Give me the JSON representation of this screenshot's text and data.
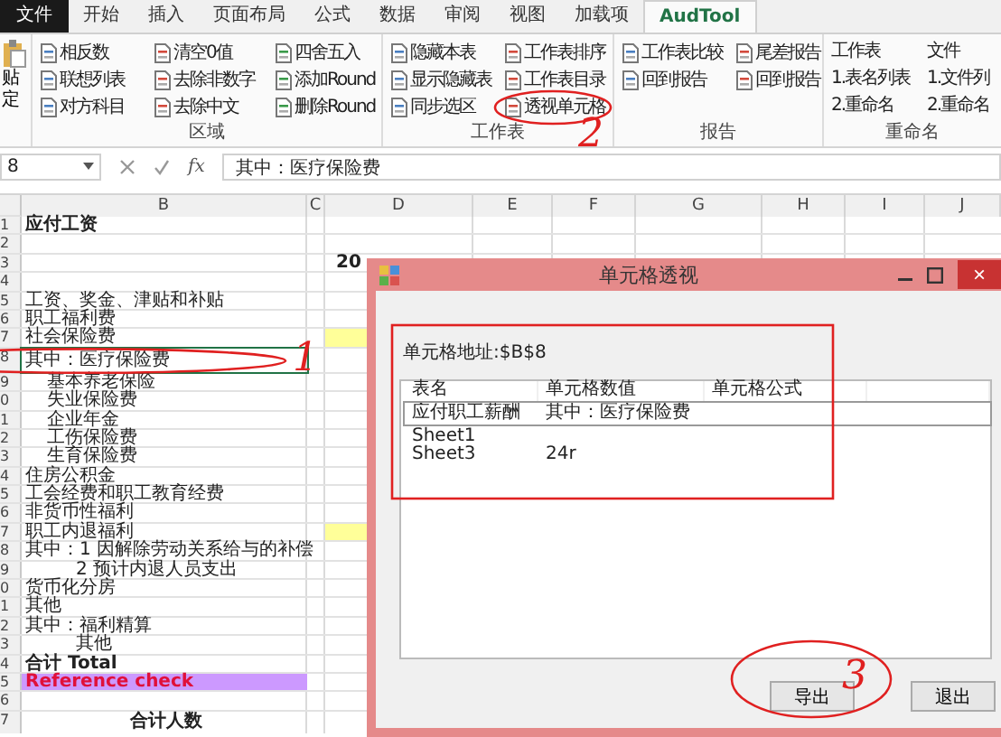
{
  "tabs": [
    {
      "label": "文件",
      "kind": "file",
      "selected": false
    },
    {
      "label": "开始",
      "kind": "tab",
      "selected": false
    },
    {
      "label": "插入",
      "kind": "tab",
      "selected": false
    },
    {
      "label": "页面布局",
      "kind": "tab",
      "selected": false
    },
    {
      "label": "公式",
      "kind": "tab",
      "selected": false
    },
    {
      "label": "数据",
      "kind": "tab",
      "selected": false
    },
    {
      "label": "审阅",
      "kind": "tab",
      "selected": false
    },
    {
      "label": "视图",
      "kind": "tab",
      "selected": false
    },
    {
      "label": "加载项",
      "kind": "tab",
      "selected": false
    },
    {
      "label": "AudTool",
      "kind": "tab",
      "selected": true
    }
  ],
  "ribbon": {
    "paste_button": [
      "贴",
      "定"
    ],
    "groups": [
      {
        "label": "区域",
        "kind": "icons",
        "columns": [
          [
            "相反数",
            "联想列表",
            "对方科目"
          ],
          [
            "清空0值",
            "去除非数字",
            "去除中文"
          ],
          [
            "四舍五入",
            "添加Round",
            "删除Round"
          ]
        ]
      },
      {
        "label": "工作表",
        "kind": "icons",
        "columns": [
          [
            "隐藏本表",
            "显示隐藏表",
            "同步选区"
          ],
          [
            "工作表排序",
            "工作表目录",
            "透视单元格"
          ]
        ]
      },
      {
        "label": "报告",
        "kind": "icons",
        "columns": [
          [
            "工作表比较",
            "回到报告"
          ],
          [
            "尾差报告",
            "回到报告"
          ]
        ]
      },
      {
        "label": "重命名",
        "kind": "text",
        "columns": [
          [
            "工作表",
            "1.表名列表",
            "2.重命名"
          ],
          [
            "文件",
            "1.文件列",
            "2.重命名"
          ]
        ]
      }
    ]
  },
  "formula_bar": {
    "name_box": "8",
    "fx": "fx",
    "formula": "其中：医疗保险费"
  },
  "sheet": {
    "columns": [
      "B",
      "C",
      "D",
      "E",
      "F",
      "G",
      "H",
      "I",
      "J"
    ],
    "rows": [
      {
        "row": "1",
        "text": "应付工资",
        "kind": "title",
        "selected": false,
        "highlight": false
      },
      {
        "row": "2",
        "text": "",
        "kind": "plain",
        "selected": false,
        "highlight": false
      },
      {
        "row": "3",
        "text": "",
        "kind": "plain",
        "selected": false,
        "highlight": false,
        "d": "20"
      },
      {
        "row": "4",
        "text": "",
        "kind": "plain",
        "selected": false,
        "highlight": false
      },
      {
        "row": "5",
        "text": "工资、奖金、津贴和补贴",
        "kind": "plain",
        "selected": false,
        "highlight": false
      },
      {
        "row": "6",
        "text": "职工福利费",
        "kind": "plain",
        "selected": false,
        "highlight": false
      },
      {
        "row": "7",
        "text": "社会保险费",
        "kind": "plain",
        "selected": false,
        "highlight": true
      },
      {
        "row": "8",
        "text": "其中：医疗保险费",
        "kind": "plain",
        "selected": true,
        "highlight": false
      },
      {
        "row": "9",
        "text": "基本养老保险",
        "kind": "indent",
        "selected": false,
        "highlight": false
      },
      {
        "row": "0",
        "text": "失业保险费",
        "kind": "indent",
        "selected": false,
        "highlight": false
      },
      {
        "row": "1",
        "text": "企业年金",
        "kind": "indent",
        "selected": false,
        "highlight": false
      },
      {
        "row": "2",
        "text": "工伤保险费",
        "kind": "indent",
        "selected": false,
        "highlight": false
      },
      {
        "row": "3",
        "text": "生育保险费",
        "kind": "indent",
        "selected": false,
        "highlight": false
      },
      {
        "row": "4",
        "text": "住房公积金",
        "kind": "plain",
        "selected": false,
        "highlight": false
      },
      {
        "row": "5",
        "text": "工会经费和职工教育经费",
        "kind": "plain",
        "selected": false,
        "highlight": false
      },
      {
        "row": "6",
        "text": "非货币性福利",
        "kind": "plain",
        "selected": false,
        "highlight": false
      },
      {
        "row": "7",
        "text": "职工内退福利",
        "kind": "plain",
        "selected": false,
        "highlight": true
      },
      {
        "row": "8",
        "text": "其中：1 因解除劳动关系给与的补偿",
        "kind": "plain",
        "selected": false,
        "highlight": false
      },
      {
        "row": "9",
        "text": "2 预计内退人员支出",
        "kind": "indent2",
        "selected": false,
        "highlight": false
      },
      {
        "row": "0",
        "text": "货币化分房",
        "kind": "plain",
        "selected": false,
        "highlight": false
      },
      {
        "row": "1",
        "text": "其他",
        "kind": "plain",
        "selected": false,
        "highlight": false
      },
      {
        "row": "2",
        "text": "其中：福利精算",
        "kind": "plain",
        "selected": false,
        "highlight": false
      },
      {
        "row": "3",
        "text": "其他",
        "kind": "indent2",
        "selected": false,
        "highlight": false
      },
      {
        "row": "4",
        "text": "合计 Total",
        "kind": "title",
        "selected": false,
        "highlight": false
      },
      {
        "row": "5",
        "text": "Reference check",
        "kind": "check",
        "selected": false,
        "highlight": false
      },
      {
        "row": "6",
        "text": "",
        "kind": "plain",
        "selected": false,
        "highlight": false
      },
      {
        "row": "7",
        "text": "合计人数",
        "kind": "center",
        "selected": false,
        "highlight": false
      }
    ]
  },
  "dialog": {
    "title": "单元格透视",
    "close": "×",
    "address": "单元格地址:$B$8",
    "columns": [
      "表名",
      "单元格数值",
      "单元格公式"
    ],
    "rows": [
      {
        "cells": [
          "应付职工薪酬",
          "其中：医疗保险费",
          ""
        ],
        "selected": true
      },
      {
        "cells": [
          "Sheet1",
          "",
          ""
        ],
        "selected": false
      },
      {
        "cells": [
          "Sheet3",
          "24r",
          ""
        ],
        "selected": false
      }
    ],
    "buttons": [
      "导出",
      "退出"
    ]
  },
  "annotations": [
    {
      "kind": "circle",
      "number": "1"
    },
    {
      "kind": "circle",
      "number": "2"
    },
    {
      "kind": "frame"
    },
    {
      "kind": "circle",
      "number": "3"
    }
  ]
}
